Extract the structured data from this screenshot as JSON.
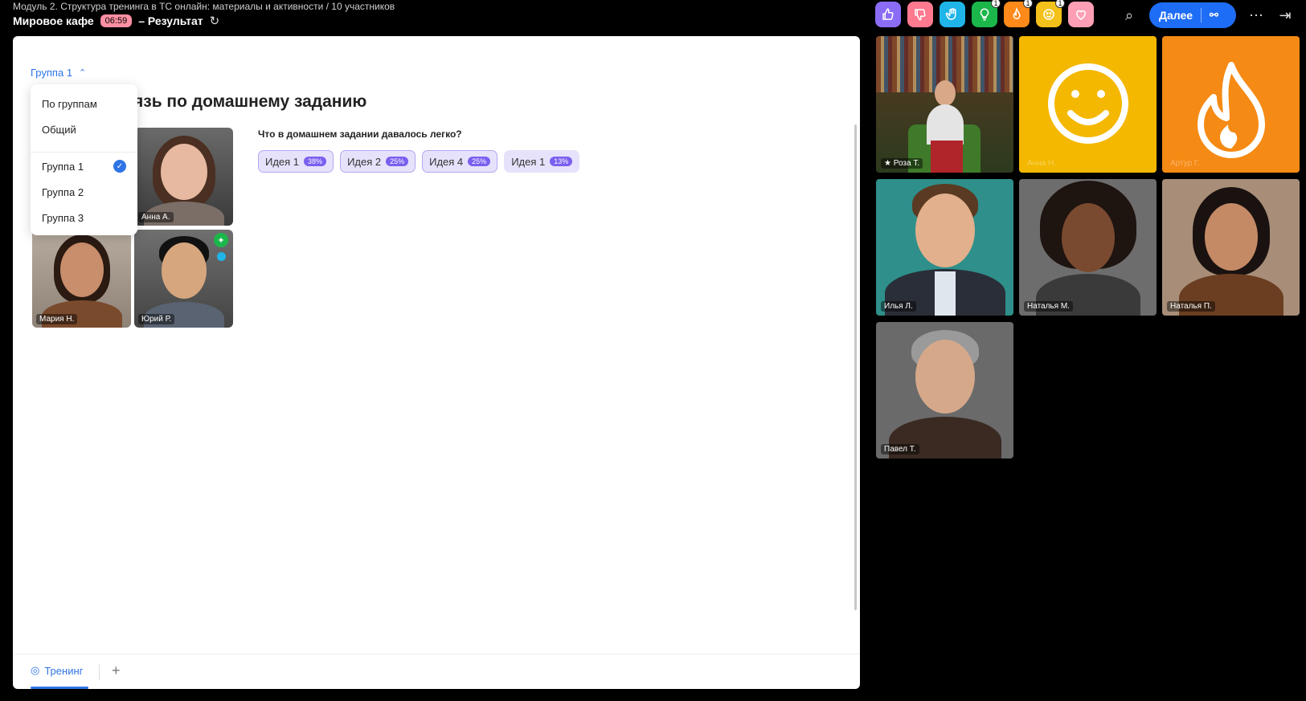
{
  "header": {
    "breadcrumb": "Модуль 2. Структура тренинга в ТС онлайн: материалы и активности / 10 участников",
    "title": "Мировое кафе",
    "timer": "06:59",
    "result": "– Результат"
  },
  "reactions": [
    {
      "icon": "thumbs-up-icon",
      "color": "#8b6cf5",
      "count": ""
    },
    {
      "icon": "thumbs-down-icon",
      "color": "#ff7a8f",
      "count": ""
    },
    {
      "icon": "raised-hand-icon",
      "color": "#1fb5e8",
      "count": ""
    },
    {
      "icon": "lightbulb-icon",
      "color": "#1bb74a",
      "count": "1"
    },
    {
      "icon": "fire-icon",
      "color": "#ff8a1a",
      "count": "1"
    },
    {
      "icon": "smile-icon",
      "color": "#f4c11a",
      "count": "1"
    },
    {
      "icon": "heart-icon",
      "color": "#ff9fb6",
      "count": ""
    }
  ],
  "toolbar": {
    "next_label": "Далее"
  },
  "main": {
    "group_selected": "Группа 1",
    "heading": "язь по домашнему заданию",
    "question": "Что в домашнем задании давалось легко?",
    "ideas": [
      {
        "label": "Идея 1",
        "pct": "38%"
      },
      {
        "label": "Идея 2",
        "pct": "25%"
      },
      {
        "label": "Идея 4",
        "pct": "25%"
      },
      {
        "label": "Идея 1",
        "pct": "13%"
      }
    ],
    "participants": [
      {
        "name": "Анна А."
      },
      {
        "name": "Мария Н."
      },
      {
        "name": "Юрий Р."
      }
    ],
    "dropdown": {
      "items": [
        "По группам",
        "Общий",
        "Группа 1",
        "Группа 2",
        "Группа 3"
      ]
    },
    "tabs": [
      {
        "label": "Тренинг"
      }
    ]
  },
  "video": [
    {
      "name": "Роза Т."
    },
    {
      "name": "Анна Н."
    },
    {
      "name": "Артур Г."
    },
    {
      "name": "Илья Л."
    },
    {
      "name": "Наталья М."
    },
    {
      "name": "Наталья П."
    },
    {
      "name": "Павел Т."
    }
  ],
  "colors": {
    "accent": "#2f74e6",
    "idea_badge": "#7b5ff0",
    "timer_bg": "#ff8fa3",
    "smile_tile": "#f4b800",
    "fire_tile": "#f58a14"
  }
}
